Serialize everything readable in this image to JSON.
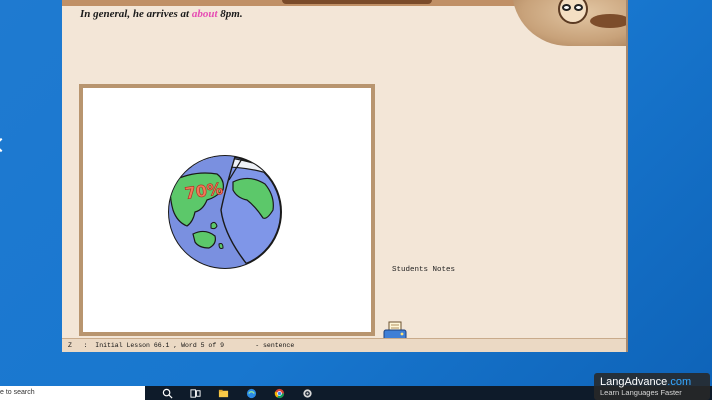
{
  "lesson": {
    "sentence_prefix": "In general, he arrives at ",
    "sentence_highlight": "about",
    "sentence_suffix": " 8pm.",
    "image_caption": "70%"
  },
  "notes": {
    "label": "Students Notes"
  },
  "statusbar": {
    "text": "Z   :  Initial Lesson 66.1 , Word 5 of 9        - sentence"
  },
  "taskbar": {
    "search_text": "e to search",
    "icons": [
      "search-icon",
      "task-view-icon",
      "file-explorer-icon",
      "edge-icon",
      "chrome-icon",
      "settings-icon"
    ]
  },
  "watermark": {
    "brand": "LangAdvance",
    "brand_suffix": ".com",
    "tagline": "Learn Languages Faster"
  },
  "colors": {
    "highlight": "#e64bb3",
    "app_background": "#f3e6d7",
    "frame": "#b8956f",
    "desktop": "#1877cf"
  }
}
